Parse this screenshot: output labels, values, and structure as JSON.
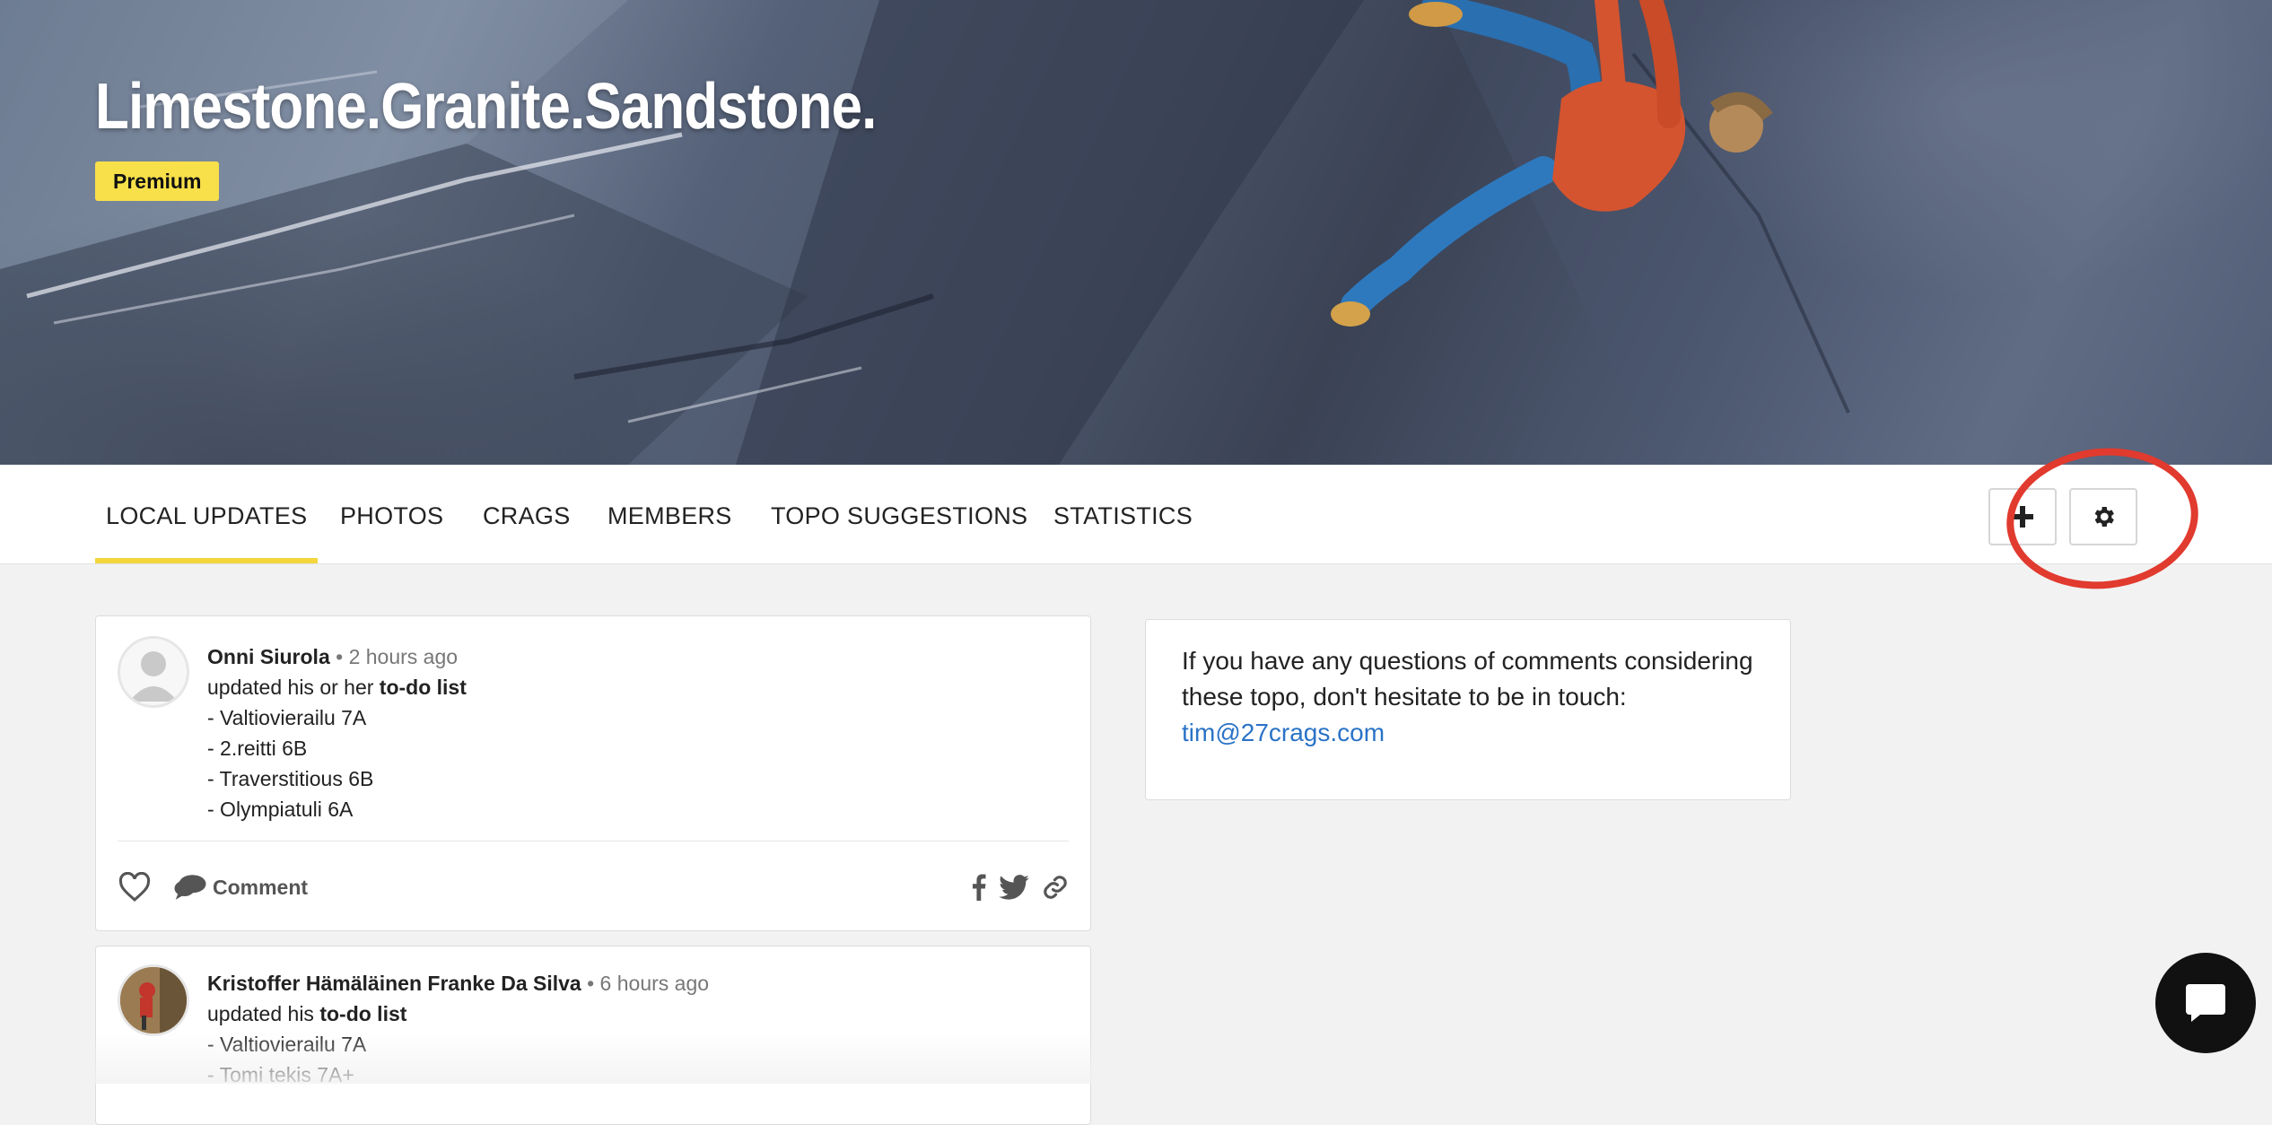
{
  "hero": {
    "title": "Limestone.Granite.Sandstone.",
    "badge": "Premium"
  },
  "tabs": [
    {
      "label": "LOCAL UPDATES",
      "active": true
    },
    {
      "label": "PHOTOS",
      "active": false
    },
    {
      "label": "CRAGS",
      "active": false
    },
    {
      "label": "MEMBERS",
      "active": false
    },
    {
      "label": "TOPO SUGGESTIONS",
      "active": false
    },
    {
      "label": "STATISTICS",
      "active": false
    }
  ],
  "toolbar": {
    "add_icon": "plus-icon",
    "settings_icon": "gear-icon",
    "highlight_color": "#e13a2e"
  },
  "feed": [
    {
      "author": "Onni Siurola",
      "time": "• 2 hours ago",
      "action_prefix": "updated his or her ",
      "action_link": "to-do list",
      "items": [
        "- Valtiovierailu 7A",
        "- 2.reitti 6B",
        "- Traverstitious 6B",
        "- Olympiatuli 6A"
      ],
      "comment_label": "Comment"
    },
    {
      "author": "Kristoffer Hämäläinen Franke Da Silva",
      "time": "• 6 hours ago",
      "action_prefix": "updated his ",
      "action_link": "to-do list",
      "items": [
        "- Valtiovierailu 7A",
        "- Tomi tekis 7A+"
      ]
    }
  ],
  "info": {
    "text": "If you have any questions of comments considering these topo, don't hesitate to be in touch:",
    "email": "tim@27crags.com"
  },
  "colors": {
    "accent": "#f3d63c",
    "badge": "#f7e04a",
    "link": "#2a73c7"
  }
}
